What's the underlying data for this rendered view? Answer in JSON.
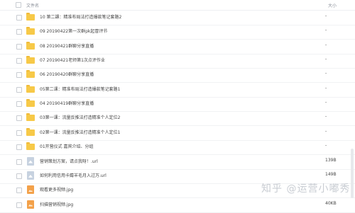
{
  "header": {
    "name_col": "文件名",
    "size_col": "大小"
  },
  "rows": [
    {
      "type": "folder",
      "name": "10 第二課：精准布局法打造爆款笔记套路2",
      "size": "-"
    },
    {
      "type": "folder",
      "name": "09 20190422第一次群pk起冒评节",
      "size": "-"
    },
    {
      "type": "folder",
      "name": "08 20190421群聊分享直播",
      "size": "-"
    },
    {
      "type": "folder",
      "name": "07 20190421老师第1次点评作业",
      "size": "-"
    },
    {
      "type": "folder",
      "name": "06 20190420群聊分享直播",
      "size": "-"
    },
    {
      "type": "folder",
      "name": "05第二课：精准布局法打造爆款笔记套路1",
      "size": "-"
    },
    {
      "type": "folder",
      "name": "04 20190419群聊分享直播",
      "size": "-"
    },
    {
      "type": "folder",
      "name": "03第一课：流量反推法打造精准个人定位2",
      "size": "-"
    },
    {
      "type": "folder",
      "name": "02第一课：流量反推法打造精准个人定位1",
      "size": "-"
    },
    {
      "type": "folder",
      "name": "01开营仪式 嘉宾介绍、分组",
      "size": "-"
    },
    {
      "type": "url",
      "name": "营销策划方案，请点我呀！.url",
      "size": "139B"
    },
    {
      "type": "url",
      "name": "如何利用信用卡薅羊毛月入过万.url",
      "size": "149B"
    },
    {
      "type": "image",
      "name": "观看更多视频.jpg",
      "size": ""
    },
    {
      "type": "image",
      "name": "扫描营销视频.jpg",
      "size": "40KB"
    }
  ],
  "watermark": "知乎 @运营小嘟秀"
}
